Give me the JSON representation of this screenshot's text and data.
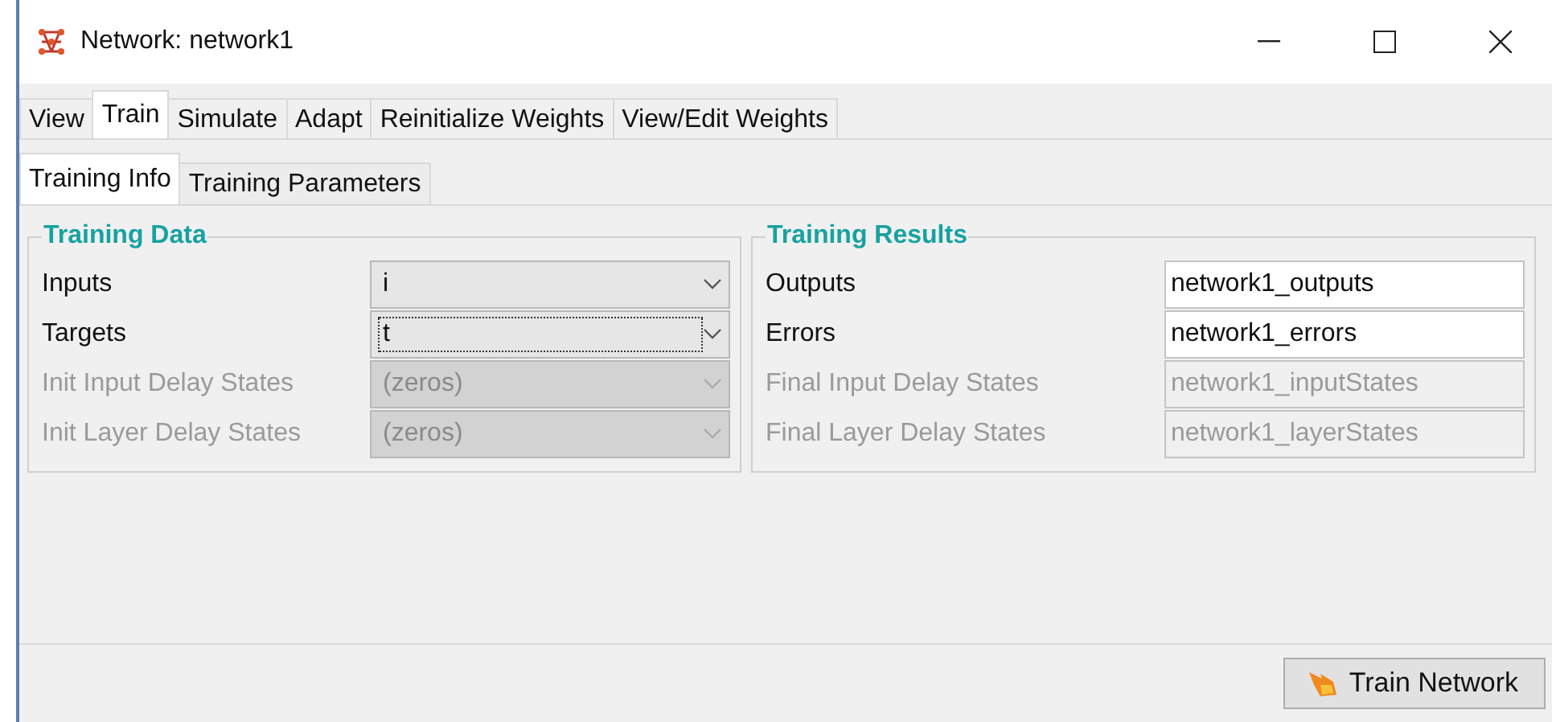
{
  "window": {
    "title": "Network: network1"
  },
  "tabs": [
    {
      "label": "View",
      "selected": false
    },
    {
      "label": "Train",
      "selected": true
    },
    {
      "label": "Simulate",
      "selected": false
    },
    {
      "label": "Adapt",
      "selected": false
    },
    {
      "label": "Reinitialize Weights",
      "selected": false
    },
    {
      "label": "View/Edit Weights",
      "selected": false
    }
  ],
  "subtabs": [
    {
      "label": "Training Info",
      "selected": true
    },
    {
      "label": "Training Parameters",
      "selected": false
    }
  ],
  "training_data": {
    "title": "Training Data",
    "rows": [
      {
        "label": "Inputs",
        "value": "i",
        "disabled": false,
        "focused": false
      },
      {
        "label": "Targets",
        "value": "t",
        "disabled": false,
        "focused": true
      },
      {
        "label": "Init Input Delay States",
        "value": "(zeros)",
        "disabled": true,
        "focused": false
      },
      {
        "label": "Init Layer Delay States",
        "value": "(zeros)",
        "disabled": true,
        "focused": false
      }
    ]
  },
  "training_results": {
    "title": "Training Results",
    "rows": [
      {
        "label": "Outputs",
        "value": "network1_outputs",
        "disabled": false
      },
      {
        "label": "Errors",
        "value": "network1_errors",
        "disabled": false
      },
      {
        "label": "Final Input Delay States",
        "value": "network1_inputStates",
        "disabled": true
      },
      {
        "label": "Final Layer Delay States",
        "value": "network1_layerStates",
        "disabled": true
      }
    ]
  },
  "train_button": {
    "label": "Train Network"
  }
}
